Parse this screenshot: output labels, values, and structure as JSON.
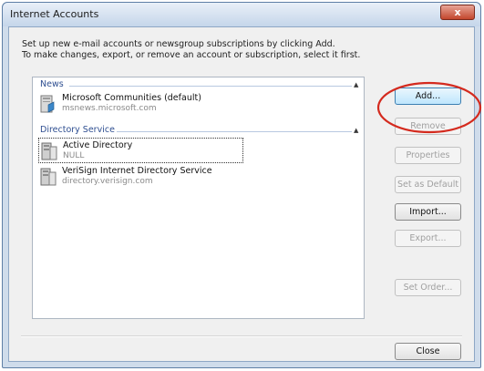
{
  "window": {
    "title": "Internet Accounts",
    "close_glyph": "x"
  },
  "instructions": {
    "line1": "Set up new e-mail accounts or newsgroup subscriptions by clicking Add.",
    "line2": "To make changes, export, or remove an account or subscription, select it first."
  },
  "accounts": {
    "groups": [
      {
        "name": "News",
        "toggle_glyph": "▲",
        "items": [
          {
            "name": "Microsoft Communities (default)",
            "server": "msnews.microsoft.com",
            "icon": "news-server-icon",
            "focused": false
          }
        ]
      },
      {
        "name": "Directory Service",
        "toggle_glyph": "▲",
        "items": [
          {
            "name": "Active Directory",
            "server": "NULL",
            "icon": "directory-server-icon",
            "focused": true
          },
          {
            "name": "VeriSign Internet Directory Service",
            "server": "directory.verisign.com",
            "icon": "directory-server-icon",
            "focused": false
          }
        ]
      }
    ]
  },
  "buttons": {
    "add": "Add...",
    "remove": "Remove",
    "properties": "Properties",
    "set_default": "Set as Default",
    "import": "Import...",
    "export": "Export...",
    "set_order": "Set Order...",
    "close": "Close"
  },
  "annotation": {
    "ring_color": "#d42a1e"
  }
}
